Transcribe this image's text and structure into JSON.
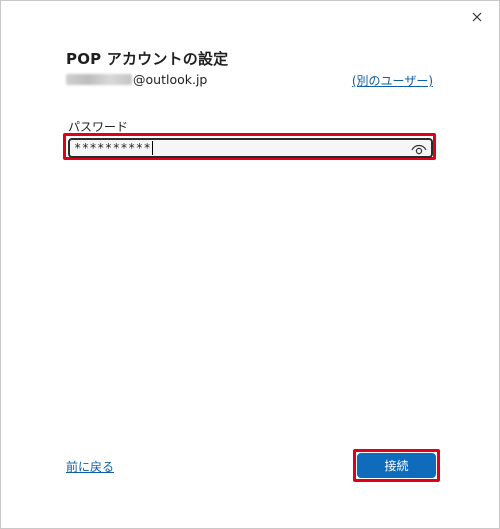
{
  "dialog": {
    "title": "POP アカウントの設定",
    "close_icon": "close-icon"
  },
  "account": {
    "email_domain": "@outlook.jp",
    "other_user_label": "(別のユーザー)"
  },
  "password": {
    "label": "パスワード",
    "value": "**********",
    "reveal_icon": "eye-icon"
  },
  "footer": {
    "back_label": "前に戻る",
    "connect_label": "接続"
  },
  "colors": {
    "accent": "#0f6cbd",
    "link": "#0f5ea8",
    "highlight": "#e0001b"
  }
}
